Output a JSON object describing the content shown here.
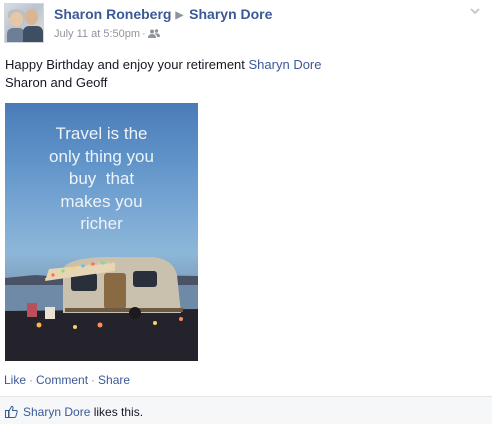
{
  "post": {
    "author": "Sharon Roneberg",
    "recipient": "Sharyn Dore",
    "timestamp": "July 11 at 5:50pm",
    "audience_icon": "friends-icon",
    "message_line1_prefix": "Happy Birthday and enjoy your retirement ",
    "message_tag": "Sharyn Dore",
    "message_line2": "Sharon and Geoff",
    "photo_quote": [
      "Travel is the",
      "only thing you",
      "buy  that",
      "makes you",
      "richer"
    ]
  },
  "actions": {
    "like": "Like",
    "comment": "Comment",
    "share": "Share",
    "separator": "·"
  },
  "likes": {
    "name": "Sharyn Dore",
    "suffix": " likes this."
  },
  "colors": {
    "link": "#3b5998",
    "muted": "#90949c",
    "text": "#141823"
  }
}
